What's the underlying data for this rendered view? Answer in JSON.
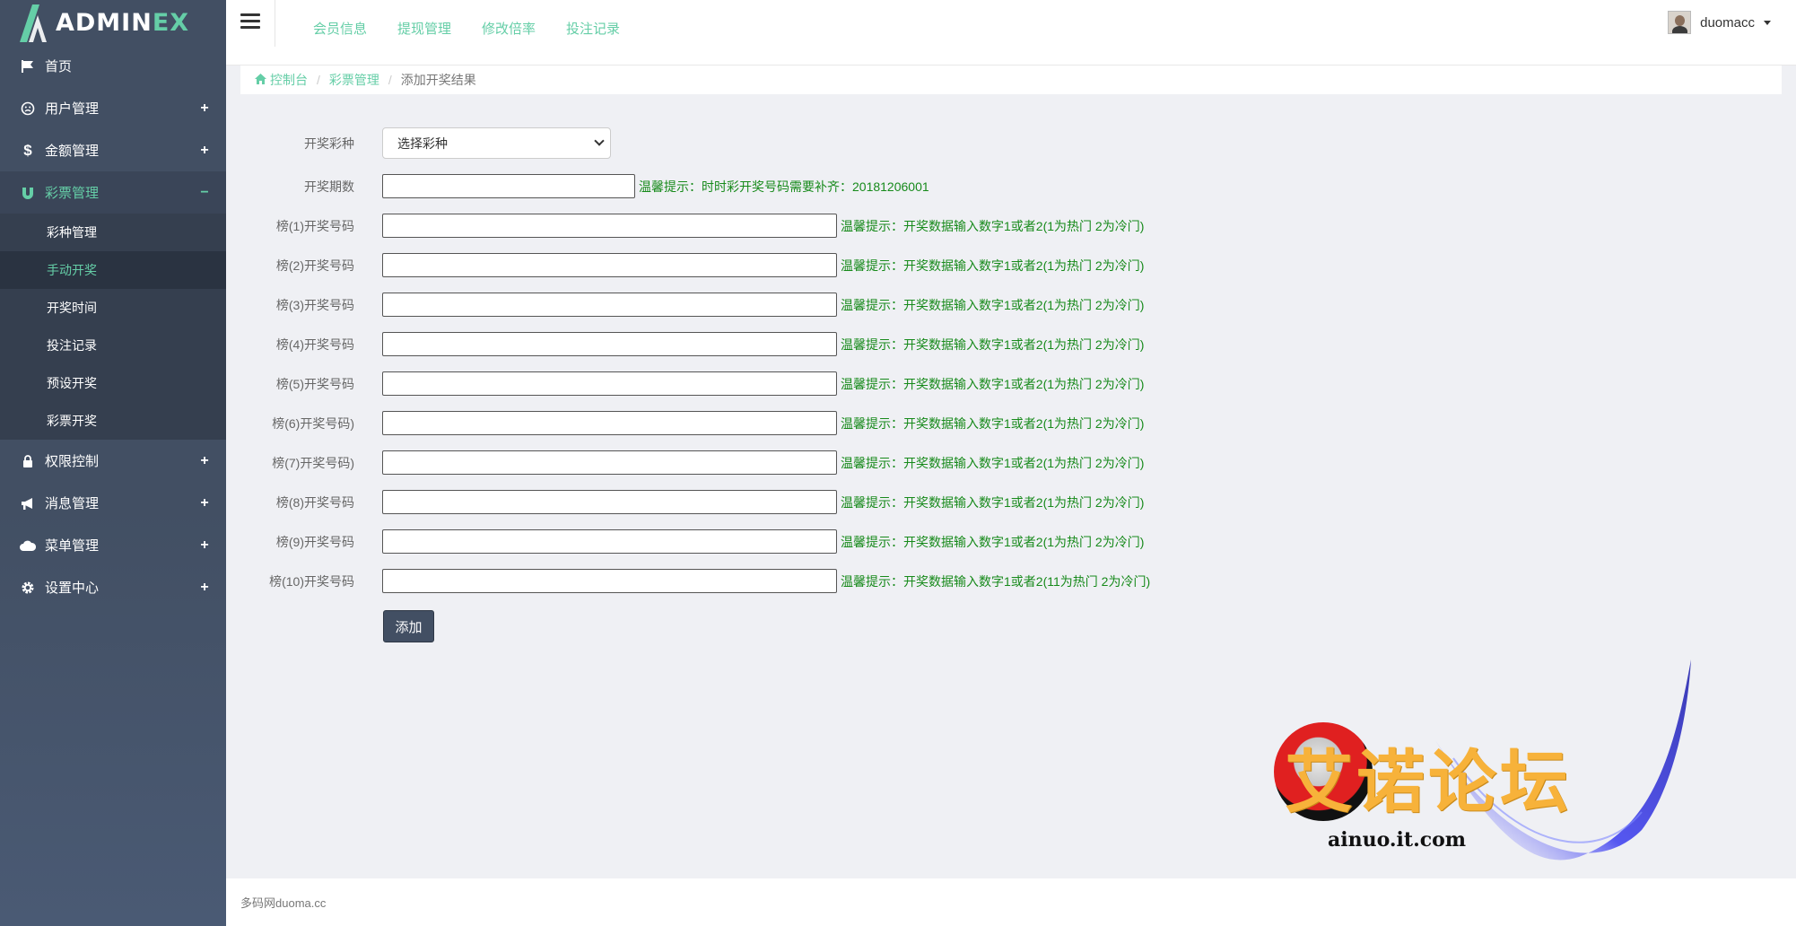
{
  "brand": {
    "name_part1": "ADMIN",
    "name_part2": "EX"
  },
  "sidebar": {
    "items": [
      {
        "label": "首页",
        "icon": "flag-icon"
      },
      {
        "label": "用户管理",
        "icon": "smile-icon",
        "sign": "+"
      },
      {
        "label": "金额管理",
        "icon": "dollar-icon",
        "sign": "+"
      },
      {
        "label": "彩票管理",
        "icon": "magnet-icon",
        "sign": "−"
      },
      {
        "label": "权限控制",
        "icon": "lock-icon",
        "sign": "+"
      },
      {
        "label": "消息管理",
        "icon": "bullhorn-icon",
        "sign": "+"
      },
      {
        "label": "菜单管理",
        "icon": "cloud-icon",
        "sign": "+"
      },
      {
        "label": "设置中心",
        "icon": "gear-icon",
        "sign": "+"
      }
    ],
    "submenu": [
      "彩种管理",
      "手动开奖",
      "开奖时间",
      "投注记录",
      "预设开奖",
      "彩票开奖"
    ]
  },
  "header": {
    "links": [
      "会员信息",
      "提现管理",
      "修改倍率",
      "投注记录"
    ],
    "username": "duomacc"
  },
  "breadcrumb": {
    "home": "控制台",
    "section": "彩票管理",
    "current": "添加开奖结果"
  },
  "form": {
    "lottery_label": "开奖彩种",
    "lottery_select": "选择彩种",
    "period_label": "开奖期数",
    "period_hint": "温馨提示：时时彩开奖号码需要补齐：20181206001",
    "number_rows": [
      {
        "label": "榜(1)开奖号码",
        "hint": "温馨提示：开奖数据输入数字1或者2(1为热门 2为冷门)"
      },
      {
        "label": "榜(2)开奖号码",
        "hint": "温馨提示：开奖数据输入数字1或者2(1为热门 2为冷门)"
      },
      {
        "label": "榜(3)开奖号码",
        "hint": "温馨提示：开奖数据输入数字1或者2(1为热门 2为冷门)"
      },
      {
        "label": "榜(4)开奖号码",
        "hint": "温馨提示：开奖数据输入数字1或者2(1为热门 2为冷门)"
      },
      {
        "label": "榜(5)开奖号码",
        "hint": "温馨提示：开奖数据输入数字1或者2(1为热门 2为冷门)"
      },
      {
        "label": "榜(6)开奖号码)",
        "hint": "温馨提示：开奖数据输入数字1或者2(1为热门 2为冷门)"
      },
      {
        "label": "榜(7)开奖号码)",
        "hint": "温馨提示：开奖数据输入数字1或者2(1为热门 2为冷门)"
      },
      {
        "label": "榜(8)开奖号码",
        "hint": "温馨提示：开奖数据输入数字1或者2(1为热门 2为冷门)"
      },
      {
        "label": "榜(9)开奖号码",
        "hint": "温馨提示：开奖数据输入数字1或者2(1为热门 2为冷门)"
      },
      {
        "label": "榜(10)开奖号码",
        "hint": "温馨提示：开奖数据输入数字1或者2(11为热门 2为冷门)"
      }
    ],
    "submit_label": "添加"
  },
  "footer": {
    "text": "多码网duoma.cc"
  },
  "watermark": {
    "title": "艾诺论坛",
    "url": "ainuo.it.com"
  },
  "colors": {
    "accent": "#65cea7",
    "sidebar": "#424f63",
    "hint": "#178a1b"
  }
}
